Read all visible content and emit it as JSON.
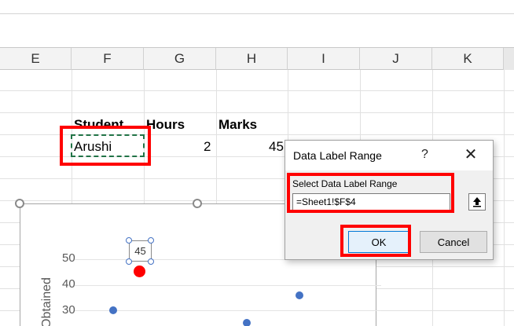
{
  "columns": [
    "E",
    "F",
    "G",
    "H",
    "I",
    "J",
    "K"
  ],
  "sheet": {
    "headers": {
      "student": "Student",
      "hours": "Hours",
      "marks": "Marks"
    },
    "row": {
      "student": "Arushi",
      "hours": "2",
      "marks": "45"
    }
  },
  "chart": {
    "ytitle": "Obtained",
    "yticks": [
      "50",
      "40",
      "30"
    ],
    "selected_label": "45",
    "point_color": "#4472c4",
    "highlight_color": "#ff0000"
  },
  "dialog": {
    "title": "Data Label Range",
    "help": "?",
    "close": "✕",
    "label": "Select Data Label Range",
    "value": "=Sheet1!$F$4",
    "ok": "OK",
    "cancel": "Cancel"
  }
}
